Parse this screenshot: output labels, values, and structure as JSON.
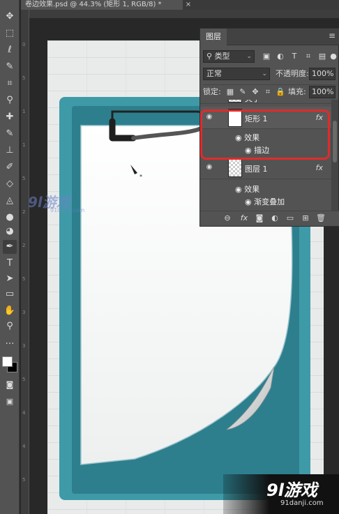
{
  "document_tab": {
    "title": "卷边效果.psd @ 44.3% (矩形 1, RGB/8) *",
    "close": "×"
  },
  "toolbar": {
    "tools": [
      "move-icon",
      "marquee-icon",
      "lasso-icon",
      "quick-select-icon",
      "crop-icon",
      "eyedropper-icon",
      "healing-brush-icon",
      "brush-icon",
      "clone-stamp-icon",
      "history-brush-icon",
      "eraser-icon",
      "paint-bucket-icon",
      "blur-icon",
      "dodge-icon",
      "pen-icon",
      "type-icon",
      "path-select-icon",
      "rectangle-icon",
      "hand-icon",
      "zoom-icon",
      "more-icon"
    ],
    "glyphs": [
      "✥",
      "⬚",
      "ℓ",
      "✎",
      "⌗",
      "⚲",
      "✚",
      "✎",
      "⊥",
      "✐",
      "◇",
      "◬",
      "●",
      "◕",
      "✒",
      "T",
      "➤",
      "▭",
      "✋",
      "⚲",
      "…"
    ],
    "foreground_color": "#ffffff",
    "background_color": "#000000"
  },
  "ruler": {
    "v_ticks": [
      "0",
      "5",
      "1",
      "1",
      "5",
      "2",
      "2",
      "5",
      "3",
      "3",
      "5",
      "4",
      "4",
      "5"
    ]
  },
  "layers_panel": {
    "tab_label": "图层",
    "filter_kind": "类型",
    "blend_mode": "正常",
    "opacity_label": "不透明度:",
    "opacity_value": "100%",
    "lock_label": "锁定:",
    "fill_label": "填充:",
    "fill_value": "100%",
    "layers": [
      {
        "name": "矢子"
      },
      {
        "name": "矩形 1",
        "fx": "fx",
        "effects_label": "效果",
        "effect": "描边"
      },
      {
        "name": "图层 1",
        "fx": "fx",
        "effects_label": "效果",
        "effect": "渐变叠加"
      }
    ]
  },
  "watermark": {
    "logo": "9l游戏",
    "url": "91danji.com",
    "logo_bottom": "9l游戏",
    "url_bottom": "91danji.com"
  },
  "colors": {
    "highlight": "#e02b2b",
    "teal": "#3f9aa8",
    "panel": "#535353"
  }
}
